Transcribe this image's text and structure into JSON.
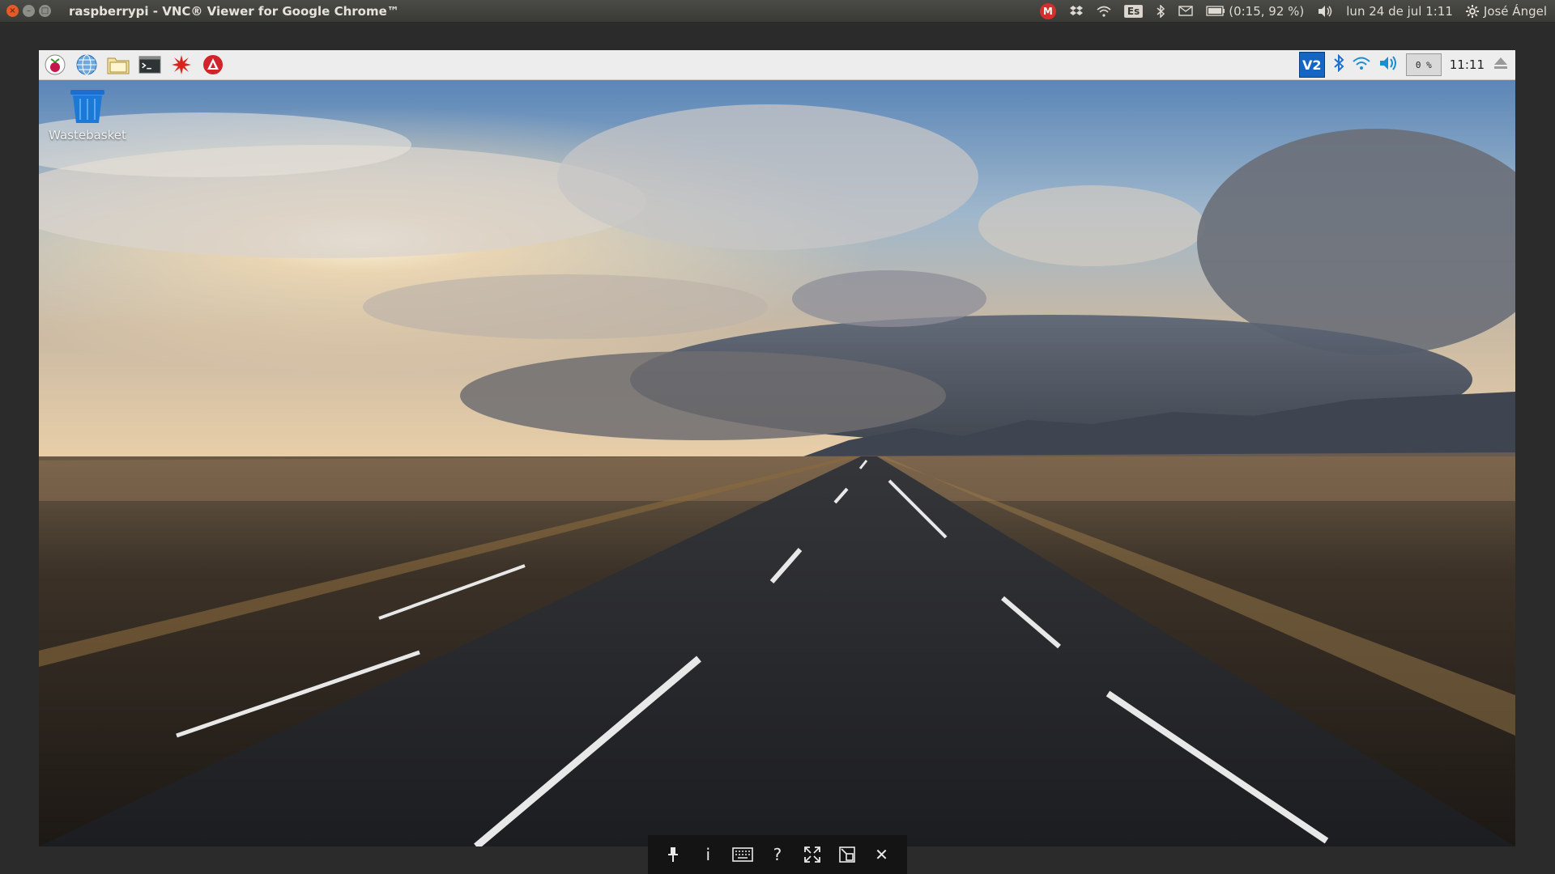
{
  "window": {
    "title": "raspberrypi - VNC® Viewer for Google Chrome™",
    "close_glyph": "×",
    "minimize_glyph": "–",
    "maximize_glyph": "□"
  },
  "top_panel": {
    "gmail_icon": "gmail-icon",
    "keyboard_layout": "Es",
    "battery": "(0:15, 92 %)",
    "date_time": "lun 24 de jul  1:11",
    "user": "José Ángel"
  },
  "pi_panel": {
    "launchers": [
      "raspberry-menu-icon",
      "web-browser-icon",
      "file-manager-icon",
      "terminal-icon",
      "mathematica-icon",
      "wolfram-icon"
    ],
    "vnc_tray_label": "V2",
    "cpu_usage": "0 %",
    "clock": "11:11"
  },
  "desktop": {
    "icons": [
      {
        "label": "Wastebasket",
        "icon": "trash-icon"
      }
    ]
  },
  "vnc_toolbar": {
    "info_label": "i",
    "help_label": "?",
    "close_label": "✕"
  },
  "colors": {
    "ubuntu_panel": "#3c3b37",
    "pi_panel": "#ededed",
    "vnc_blue": "#1466c2",
    "toolbar": "#141414"
  }
}
